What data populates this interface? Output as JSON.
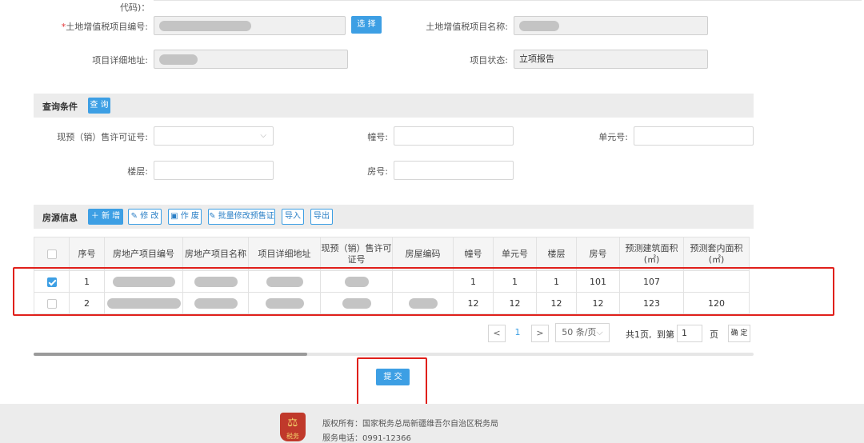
{
  "form": {
    "top_label_fragment": "代码)：",
    "project_code_star": "*",
    "project_code_label": "土地增值税项目编号:",
    "select_button": "选 择",
    "project_name_label": "土地增值税项目名称:",
    "address_label": "项目详细地址:",
    "status_label": "项目状态:",
    "status_value": "立项报告"
  },
  "query": {
    "title": "查询条件",
    "button": "查 询",
    "permit_label": "现预（销）售许可证号:",
    "building_label": "幢号:",
    "unit_label": "单元号:",
    "floor_label": "楼层:",
    "room_label": "房号:"
  },
  "housing": {
    "title": "房源信息",
    "buttons": {
      "add": "＋ 新 增",
      "edit": "修 改",
      "void": "作 废",
      "batch": "批量修改预售证",
      "import": "导入",
      "export": "导出"
    },
    "columns": [
      "序号",
      "房地产项目编号",
      "房地产项目名称",
      "项目详细地址",
      "现预（销）售许可证号",
      "房屋编码",
      "幢号",
      "单元号",
      "楼层",
      "房号",
      "预测建筑面积(㎡)",
      "预测套内面积(㎡)"
    ],
    "rows": [
      {
        "seq": "1",
        "building": "1",
        "unit": "1",
        "floor": "1",
        "room": "101",
        "build_area": "107",
        "inner_area": "",
        "checked": true
      },
      {
        "seq": "2",
        "building": "12",
        "unit": "12",
        "floor": "12",
        "room": "12",
        "build_area": "123",
        "inner_area": "120",
        "checked": false
      }
    ]
  },
  "pagination": {
    "prev": "<",
    "current_page": "1",
    "next": ">",
    "page_size": "50 条/页",
    "total": "共1页,",
    "goto_label": "到第",
    "goto_value": "1",
    "page_unit": "页",
    "confirm": "确 定"
  },
  "submit": "提 交",
  "footer": {
    "logo_text": "税务",
    "copyright": "版权所有：国家税务总局新疆维吾尔自治区税务局",
    "phone": "服务电话：0991-12366"
  },
  "colors": {
    "primary": "#3d9fe4",
    "annotation": "#e0201b"
  }
}
